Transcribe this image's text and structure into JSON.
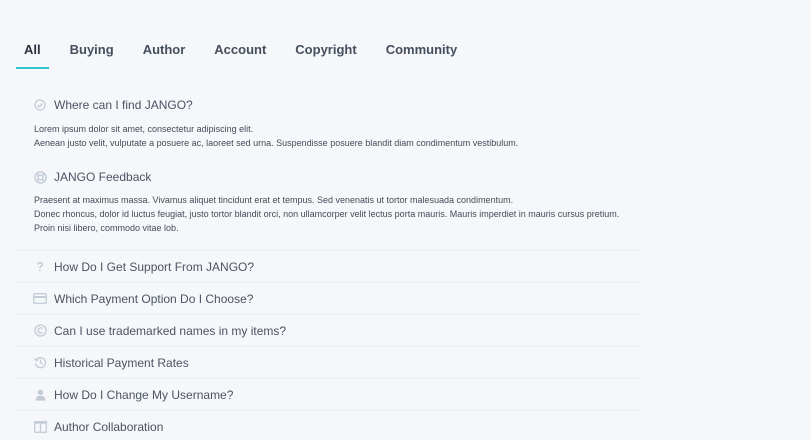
{
  "tabs": [
    {
      "label": "All",
      "active": true
    },
    {
      "label": "Buying",
      "active": false
    },
    {
      "label": "Author",
      "active": false
    },
    {
      "label": "Account",
      "active": false
    },
    {
      "label": "Copyright",
      "active": false
    },
    {
      "label": "Community",
      "active": false
    }
  ],
  "accent_color": "#2cc6cc",
  "faq": [
    {
      "title": "Where can I find JANGO?",
      "icon": "check-circle-icon",
      "expanded": true,
      "body": [
        "Lorem ipsum dolor sit amet, consectetur adipiscing elit.",
        "Aenean justo velit, vulputate a posuere ac, laoreet sed urna. Suspendisse posuere blandit diam condimentum vestibulum."
      ]
    },
    {
      "title": "JANGO Feedback",
      "icon": "lifebuoy-icon",
      "expanded": true,
      "body": [
        "Praesent at maximus massa. Vivamus aliquet tincidunt erat et tempus. Sed venenatis ut tortor malesuada condimentum.",
        "Donec rhoncus, dolor id luctus feugiat, justo tortor blandit orci, non ullamcorper velit lectus porta mauris. Mauris imperdiet in mauris cursus pretium. Proin nisi libero, commodo vitae lob."
      ]
    },
    {
      "title": "How Do I Get Support From JANGO?",
      "icon": "question-icon",
      "expanded": false
    },
    {
      "title": "Which Payment Option Do I Choose?",
      "icon": "credit-card-icon",
      "expanded": false
    },
    {
      "title": "Can I use trademarked names in my items?",
      "icon": "copyright-icon",
      "expanded": false
    },
    {
      "title": "Historical Payment Rates",
      "icon": "history-icon",
      "expanded": false
    },
    {
      "title": "How Do I Change My Username?",
      "icon": "user-icon",
      "expanded": false
    },
    {
      "title": "Author Collaboration",
      "icon": "columns-icon",
      "expanded": false
    }
  ]
}
